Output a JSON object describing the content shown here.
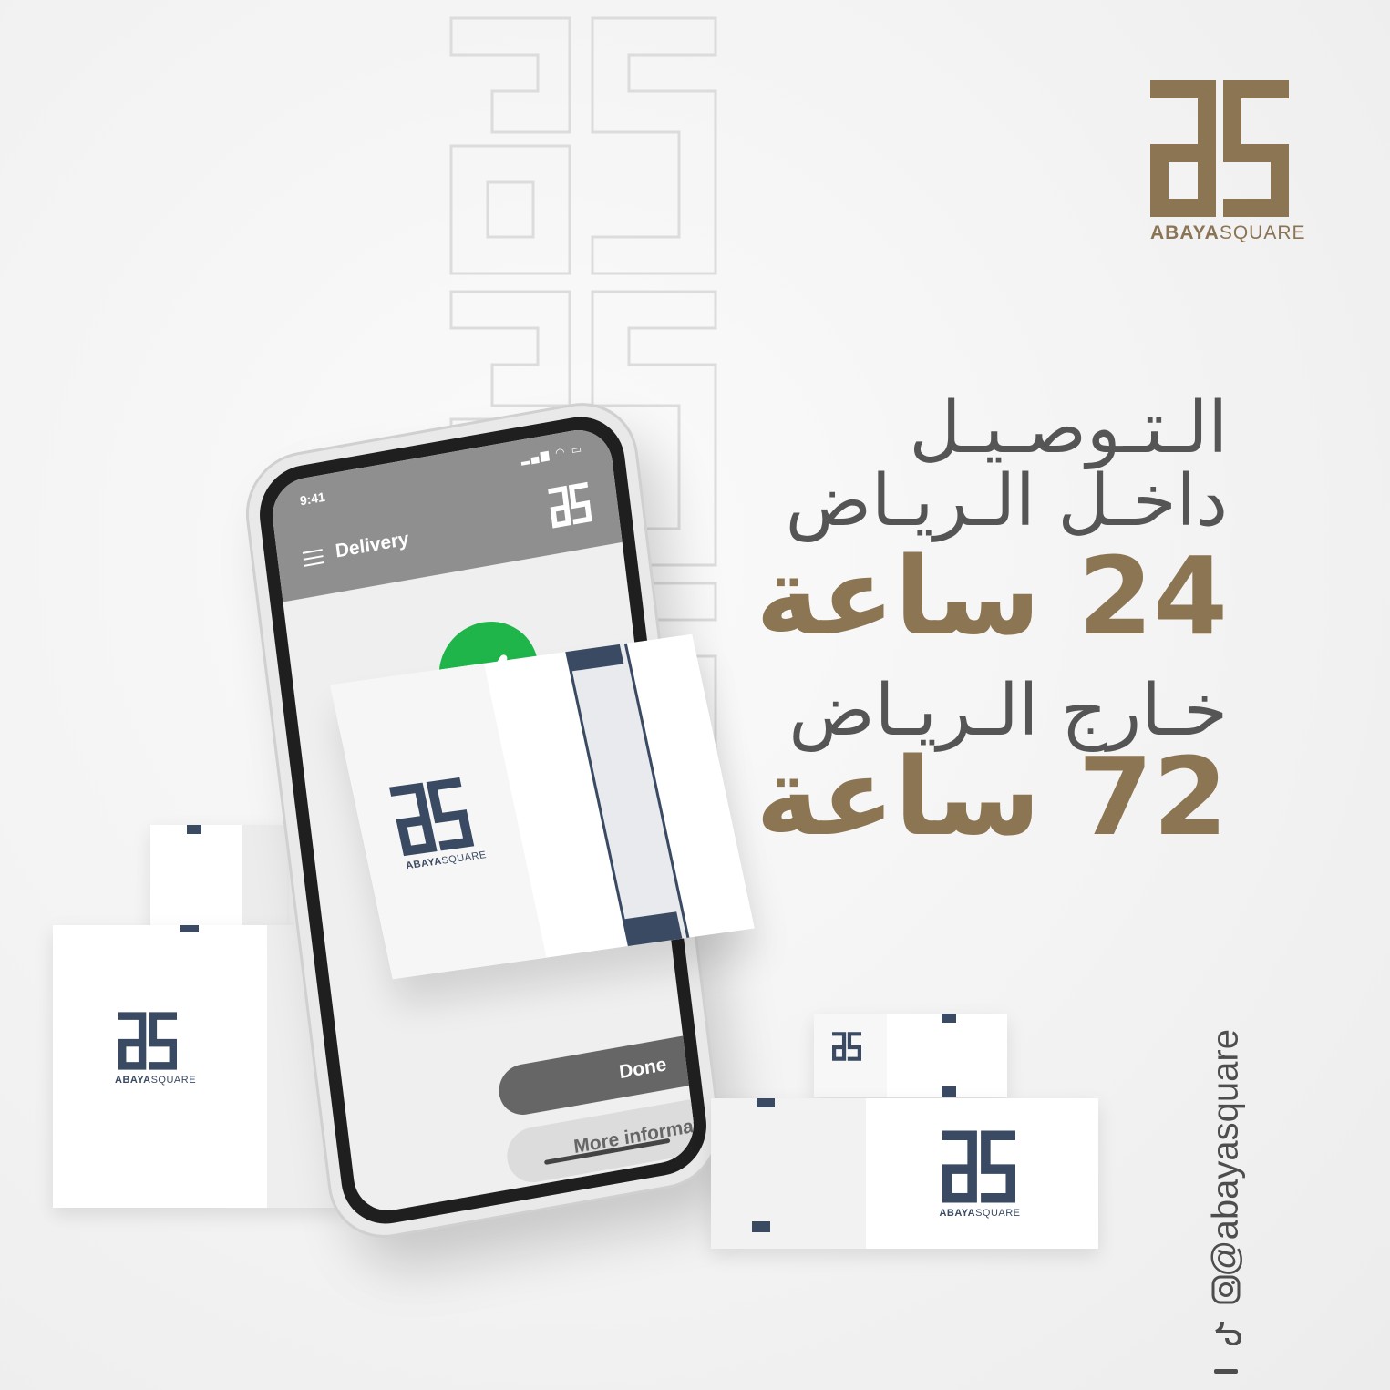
{
  "brand": {
    "name_bold": "ABAYA",
    "name_light": "SQUARE",
    "gold": "#8c7552",
    "navy": "#3a4a62"
  },
  "headline": {
    "inside_line1": "الـتـوصـيـل",
    "inside_line2": "داخـل الـريـاض",
    "inside_time": "24 ساعة",
    "outside_line1": "خـارج الـريـاض",
    "outside_time": "72 ساعة"
  },
  "social": {
    "handle": "@abayasquare",
    "icons": [
      "instagram-icon",
      "tiktok-icon",
      "snapchat-icon"
    ]
  },
  "phone": {
    "status_time": "9:41",
    "status_icons": "▂▄▆ ◠ ▭",
    "app_title": "Delivery",
    "status_check_color": "#1fb54a",
    "done_label": "Done",
    "more_info_label": "More information"
  },
  "boxes": {
    "logo_bold": "ABAYA",
    "logo_light": "SQUARE"
  }
}
